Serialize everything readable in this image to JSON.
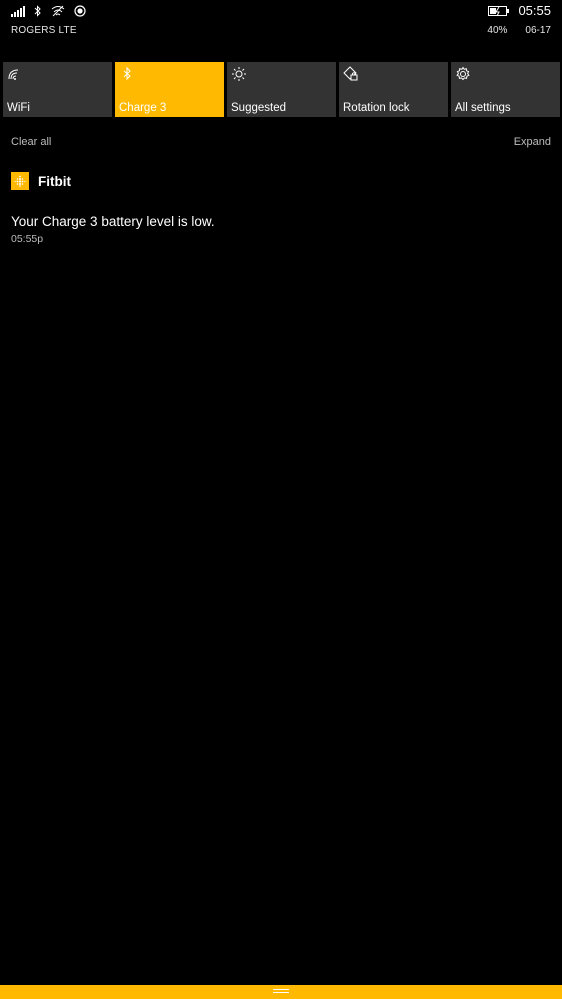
{
  "status_bar": {
    "carrier": "ROGERS LTE",
    "time": "05:55",
    "battery_percent": "40%",
    "date": "06-17",
    "icons": [
      "signal-strength-icon",
      "bluetooth-icon",
      "wifi-off-icon",
      "location-icon",
      "battery-charging-icon"
    ]
  },
  "quick_actions": [
    {
      "label": "WiFi",
      "icon": "wifi-icon",
      "active": false
    },
    {
      "label": "Charge 3",
      "icon": "bluetooth-icon",
      "active": true
    },
    {
      "label": "Suggested",
      "icon": "brightness-icon",
      "active": false
    },
    {
      "label": "Rotation lock",
      "icon": "rotation-lock-icon",
      "active": false
    },
    {
      "label": "All settings",
      "icon": "gear-icon",
      "active": false
    }
  ],
  "actions": {
    "clear_all": "Clear all",
    "expand": "Expand"
  },
  "notifications": {
    "app_name": "Fitbit",
    "app_icon": "fitbit-icon",
    "items": [
      {
        "text": "Your Charge 3 battery level is low.",
        "time": "05:55p"
      }
    ]
  },
  "colors": {
    "accent": "#ffb900",
    "tile_background": "#333333",
    "background": "#000000",
    "secondary_text": "#bdbdbd"
  }
}
